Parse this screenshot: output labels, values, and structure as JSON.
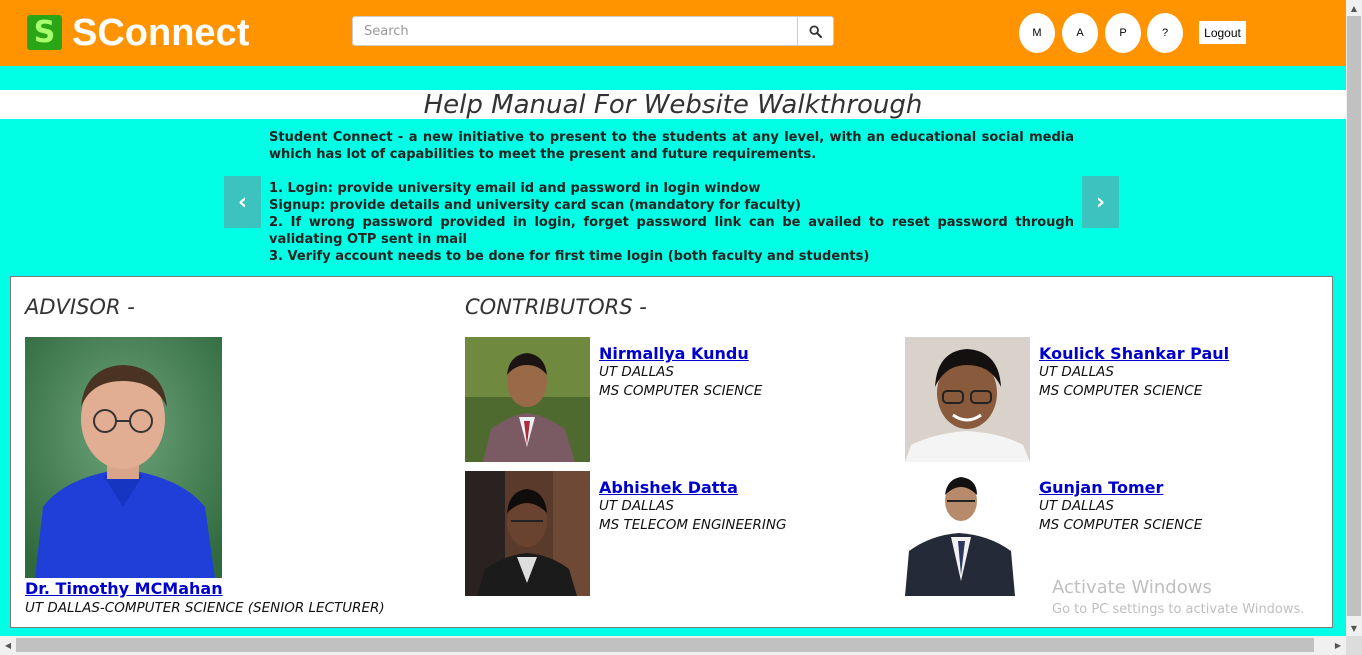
{
  "header": {
    "logo_letter": "S",
    "brand": "SConnect",
    "search_placeholder": "Search",
    "circle_buttons": [
      "M",
      "A",
      "P",
      "?"
    ],
    "logout_label": "Logout"
  },
  "help": {
    "title": "Help Manual For Website Walkthrough",
    "intro": "Student Connect - a new initiative to present to the students at any level, with an educational social media which has lot of capabilities to meet the present and future requirements.",
    "steps": [
      "1. Login: provide university email id and password in login window",
      "Signup: provide details and university card scan (mandatory for faculty)",
      "2. If wrong password provided in login, forget password link can be availed to reset password through validating OTP sent in mail",
      "3. Verify account needs to be done for first time login (both faculty and students)"
    ],
    "prev_glyph": "‹",
    "next_glyph": "›"
  },
  "advisor": {
    "heading": "ADVISOR -",
    "name": "Dr. Timothy MCMahan",
    "detail": "UT DALLAS-COMPUTER SCIENCE (SENIOR LECTURER)"
  },
  "contributors": {
    "heading": "CONTRIBUTORS -",
    "people": [
      {
        "name": "Nirmallya Kundu",
        "org": "UT DALLAS",
        "program": "MS COMPUTER SCIENCE"
      },
      {
        "name": "Koulick Shankar Paul",
        "org": "UT DALLAS",
        "program": "MS COMPUTER SCIENCE"
      },
      {
        "name": "Abhishek Datta",
        "org": "UT DALLAS",
        "program": "MS TELECOM ENGINEERING"
      },
      {
        "name": "Gunjan Tomer",
        "org": "UT DALLAS",
        "program": "MS COMPUTER SCIENCE"
      }
    ]
  },
  "watermark": {
    "title": "Activate Windows",
    "subtitle": "Go to PC settings to activate Windows."
  },
  "colors": {
    "header": "#FF9400",
    "page_bg": "#00FFE5",
    "link": "#0000CC"
  }
}
